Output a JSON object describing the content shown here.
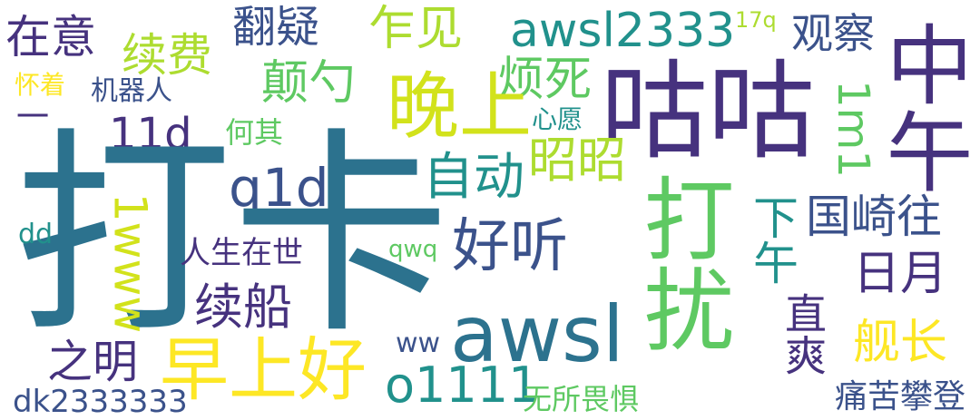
{
  "colors": {
    "background": "#ffffff",
    "dark_purple": "#46327e",
    "indigo": "#3b528b",
    "slate_blue": "#365c8d",
    "blue": "#2c728e",
    "teal": "#21918c",
    "sea_green": "#28ae80",
    "green": "#5ec962",
    "lime": "#addc30",
    "yellow": "#fde725"
  },
  "words": [
    "打卡",
    "咕咕",
    "打扰",
    "中午",
    "晚上",
    "awsl",
    "早上好",
    "好听",
    "awsl2333",
    "o1111",
    "在意",
    "翻疑",
    "乍见",
    "观察",
    "续费",
    "颠勺",
    "烦死",
    "自动",
    "昭昭",
    "q1d",
    "11d",
    "1m1",
    "国崎往",
    "日月",
    "下午",
    "1www",
    "续船",
    "之明",
    "直爽",
    "舰长",
    "dk2333333",
    "痛苦攀登",
    "无所畏惧",
    "人生在世",
    "机器人",
    "怀着",
    "一",
    "何其",
    "心愿",
    "17q",
    "dd",
    "qwq",
    "ww"
  ]
}
